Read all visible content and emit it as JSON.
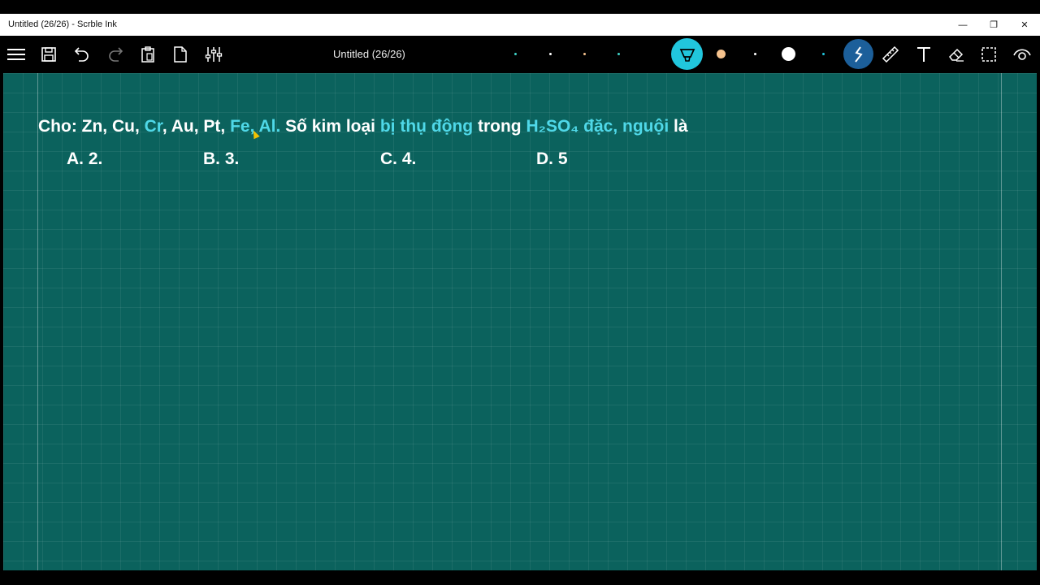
{
  "window": {
    "title": "Untitled (26/26) - Scrble Ink",
    "minimize_glyph": "—",
    "restore_glyph": "❐",
    "close_glyph": "✕"
  },
  "toolbar": {
    "doc_title": "Untitled (26/26)",
    "icons": [
      "menu-icon",
      "save-icon",
      "undo-icon",
      "redo-icon",
      "clipboard-icon",
      "new-page-icon",
      "settings-sliders-icon",
      "highlighter-icon",
      "ruler-icon",
      "text-icon",
      "eraser-icon",
      "selection-icon",
      "eye-icon"
    ],
    "colors": {
      "accent_cyan": "#21c6dd",
      "pen_color": "#f5c38e",
      "pen_active": "#1c5f9a"
    }
  },
  "question": {
    "parts": [
      {
        "t": "Cho: Zn, Cu, ",
        "hl": false
      },
      {
        "t": "Cr",
        "hl": true
      },
      {
        "t": ", Au, Pt, ",
        "hl": false
      },
      {
        "t": "Fe, Al.",
        "hl": true
      },
      {
        "t": " Số kim loại ",
        "hl": false
      },
      {
        "t": "bị thụ động",
        "hl": true
      },
      {
        "t": " trong ",
        "hl": false
      },
      {
        "t": "H₂SO₄ đặc, nguội",
        "hl": true
      },
      {
        "t": " là",
        "hl": false
      }
    ],
    "highlight_color": "#4fd8e8",
    "options": {
      "a": "A. 2.",
      "b": "B. 3.",
      "c": "C. 4.",
      "d": "D. 5"
    }
  },
  "canvas": {
    "background": "#0b625d"
  }
}
